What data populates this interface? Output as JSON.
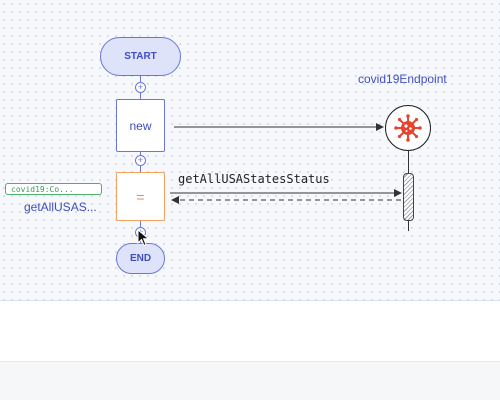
{
  "flow": {
    "start_label": "START",
    "end_label": "END",
    "plus_symbol": "+",
    "new_node_label": "new",
    "action_node_label": "=",
    "endpoint_name": "covid19Endpoint",
    "endpoint_icon": "virus-icon",
    "call_label": "getAllUSAStatesStatus",
    "variable_type": "covid19:Co...",
    "variable_name": "getAllUSAS..."
  },
  "colors": {
    "node_border": "#6b77d8",
    "node_fill": "#dfe3fa",
    "action_border": "#f3a35f",
    "variable_green": "#4caf6a",
    "virus_red": "#e5452f"
  }
}
